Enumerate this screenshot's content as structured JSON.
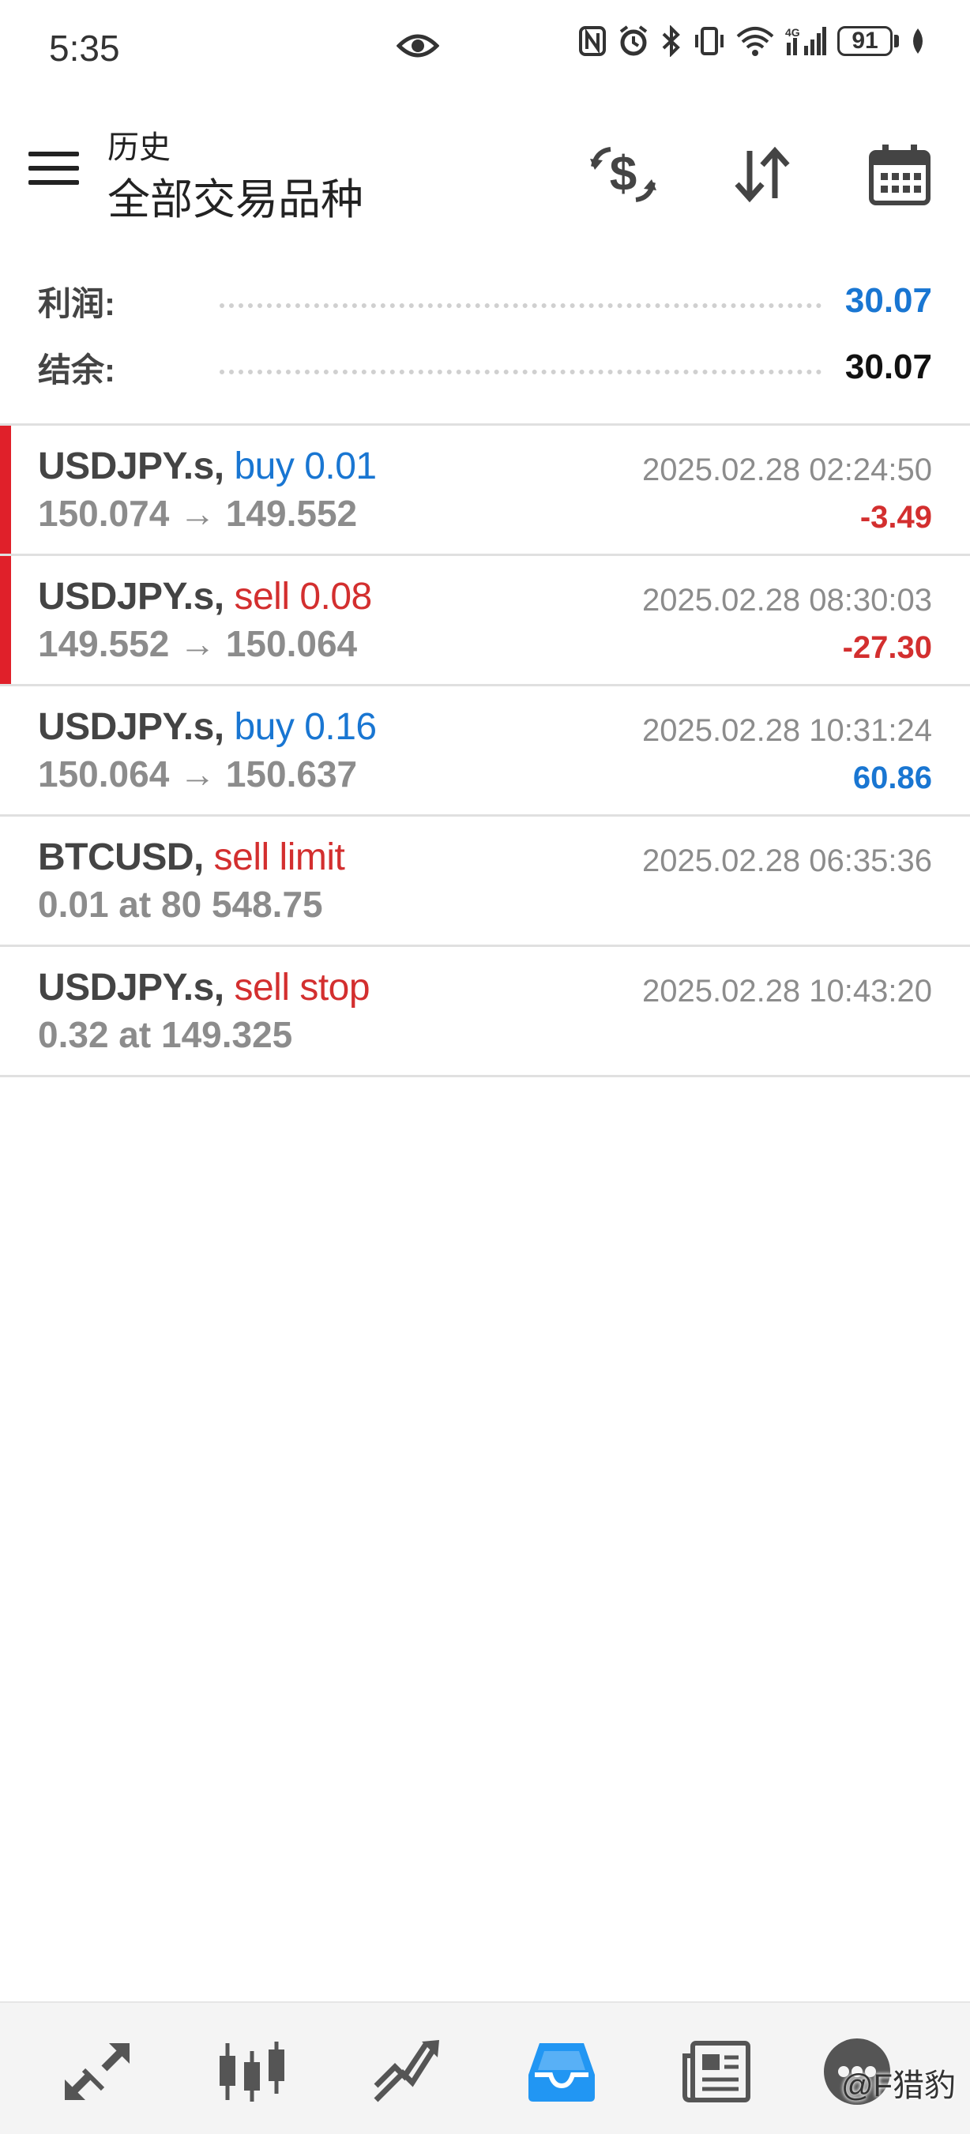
{
  "status": {
    "time": "5:35",
    "battery": "91"
  },
  "header": {
    "subtitle": "历史",
    "title": "全部交易品种"
  },
  "summary": {
    "profit_label": "利润:",
    "profit_value": "30.07",
    "balance_label": "结余:",
    "balance_value": "30.07"
  },
  "trades": [
    {
      "symbol": "USDJPY.s,",
      "side": "buy 0.01",
      "prices": "150.074 → 149.552",
      "time": "2025.02.28 02:24:50",
      "profit": "-3.49"
    },
    {
      "symbol": "USDJPY.s,",
      "side": "sell 0.08",
      "prices": "149.552 → 150.064",
      "time": "2025.02.28 08:30:03",
      "profit": "-27.30"
    },
    {
      "symbol": "USDJPY.s,",
      "side": "buy 0.16",
      "prices": "150.064 → 150.637",
      "time": "2025.02.28 10:31:24",
      "profit": "60.86"
    },
    {
      "symbol": "BTCUSD,",
      "side": "sell limit",
      "prices": "0.01 at 80 548.75",
      "time": "2025.02.28 06:35:36",
      "profit": ""
    },
    {
      "symbol": "USDJPY.s,",
      "side": "sell stop",
      "prices": "0.32 at 149.325",
      "time": "2025.02.28 10:43:20",
      "profit": ""
    }
  ],
  "colors": {
    "buy": "#1976d2",
    "sell": "#d32f2f",
    "loss_flag": "#e0202a",
    "active_tab": "#2196f3"
  },
  "icons": [
    "menu-icon",
    "currency-exchange-icon",
    "sort-icon",
    "calendar-icon",
    "quotes-icon",
    "chart-icon",
    "trade-icon",
    "history-icon",
    "news-icon",
    "chat-icon"
  ],
  "watermark": "@F猎豹"
}
